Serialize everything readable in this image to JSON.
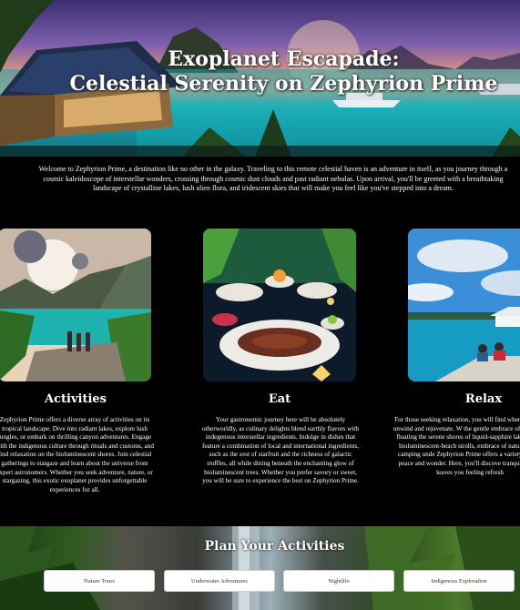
{
  "hero": {
    "title_line1": "Exoplanet Escapade:",
    "title_line2": "Celestial Serenity on Zephyrion Prime"
  },
  "intro": "Welcome to Zephyrion Prime, a destination like no other in the galaxy. Traveling to this remote celestial haven is an adventure in itself, as you journey through a cosmic kaleidoscope of interstellar wonders, crossing through cosmic dust clouds and past radiant nebulas. Upon arrival, you'll be greeted with a breathtaking landscape of crystalline lakes, lush alien flora, and iridescent skies that will make you feel like you've stepped into a dream.",
  "features": [
    {
      "title": "Activities",
      "text": "Zephyrion Prime offers a diverse array of activities on its tropical landscape. Dive into radiant lakes, explore lush jungles, or embark on thrilling canyon adventures. Engage with the indigenous culture through rituals and customs, and find relaxation on the bioluminescent shores. Join celestial gatherings to stargaze and learn about the universe from expert astronomers. Whether you seek adventure, nature, or stargazing, this exotic exoplanet provides unforgettable experiences for all."
    },
    {
      "title": "Eat",
      "text": "Your gastronomic journey here will be absolutely otherworldly, as culinary delights blend earthly flavors with indegenous interstellar ingredients. Indulge in dishes that feature a combination of local and international ingredients, such as the zest of starfruit and the richness of galactic truffles, all while dining beneath the enchanting glow of bioluminescent trees. Whether you prefer savory or sweet, you will be sure to experience the best on Zephyrion Prime."
    },
    {
      "title": "Relax",
      "text": "For those seeking relaxation, you will find where you can unwind and rejuvenate. W the gentle embrace of luxurious floating the serene shores of liquid-sapphire lak moonlit bioluminescent-beach strolls, embrace of nature while camping unde Zephyrion Prime offers a variety of setti peace and wonder. Here, you'll discove tranquility that leaves you feeling refresh"
    }
  ],
  "plan": {
    "title": "Plan Your Activities",
    "buttons": [
      "Nature Tours",
      "Underwater Adventures",
      "Nightlife",
      "Indigenous Exploration"
    ]
  },
  "colors": {
    "page_background": "#000000",
    "text": "#ffffff",
    "button_background": "#ffffff",
    "button_text": "#333333"
  }
}
